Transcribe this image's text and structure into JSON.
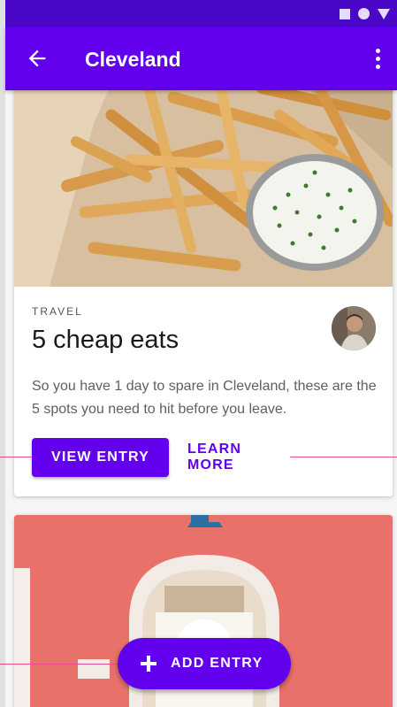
{
  "status_bar": {
    "icons": [
      "square-icon",
      "circle-icon",
      "triangle-icon"
    ],
    "color": "#4b07c8"
  },
  "app_bar": {
    "title": "Cleveland",
    "back_icon": "arrow-back-icon",
    "menu_icon": "more-vert-icon",
    "color": "#6200ee"
  },
  "card": {
    "image": "fries-with-dip-image",
    "overline": "TRAVEL",
    "title": "5 cheap eats",
    "body": "So you have 1 day to spare in Cleveland, these are the 5 spots you need to hit before you leave.",
    "primary_action": "VIEW ENTRY",
    "secondary_action": "LEARN MORE",
    "avatar": "author-avatar"
  },
  "second_card": {
    "image": "arched-doorway-pink-wall-image"
  },
  "fab": {
    "label": "ADD ENTRY",
    "icon": "plus-icon"
  },
  "colors": {
    "primary": "#6200ee",
    "accent_line": "#ea4b8c"
  }
}
